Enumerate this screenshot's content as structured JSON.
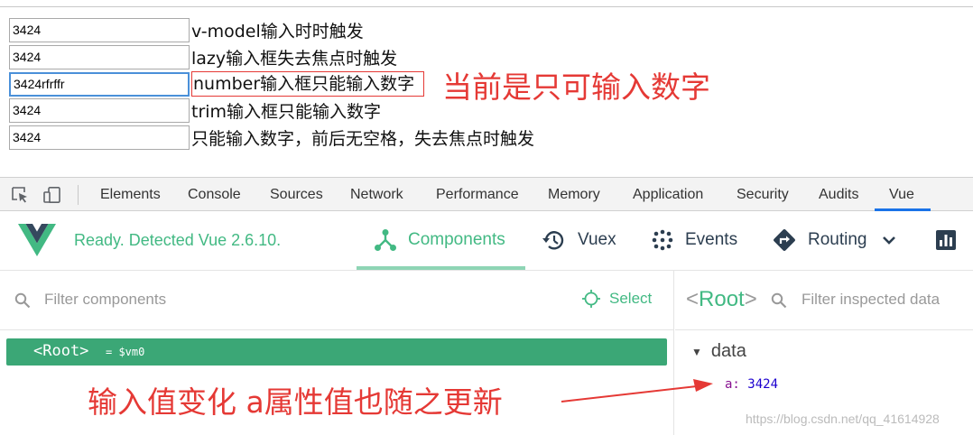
{
  "demo": {
    "rows": [
      {
        "value": "3424",
        "label": "v-model输入时时触发"
      },
      {
        "value": "3424",
        "label": "lazy输入框失去焦点时触发"
      },
      {
        "value": "3424rfrffr",
        "label": "number输入框只能输入数字"
      },
      {
        "value": "3424",
        "label": "trim输入框只能输入数字"
      },
      {
        "value": "3424",
        "label": "只能输入数字，前后无空格，失去焦点时触发"
      }
    ],
    "annotation": "当前是只可输入数字"
  },
  "devtools": {
    "tabs": [
      "Elements",
      "Console",
      "Sources",
      "Network",
      "Performance",
      "Memory",
      "Application",
      "Security",
      "Audits",
      "Vue"
    ],
    "active_tab": "Vue"
  },
  "vue": {
    "status": "Ready. Detected Vue 2.6.10.",
    "nav": {
      "components": "Components",
      "vuex": "Vuex",
      "events": "Events",
      "routing": "Routing"
    },
    "accent_color": "#42b983",
    "filter_components_placeholder": "Filter components",
    "select_label": "Select",
    "root_tag": "<Root>",
    "root_vm": "= $vm0",
    "inspected": {
      "title_open": "<",
      "title_name": "Root",
      "title_close": ">",
      "filter_placeholder": "Filter inspected data",
      "section": "data",
      "key": "a:",
      "value": "3424"
    }
  },
  "annotation_bottom": "输入值变化  a属性值也随之更新",
  "watermark": "https://blog.csdn.net/qq_41614928"
}
